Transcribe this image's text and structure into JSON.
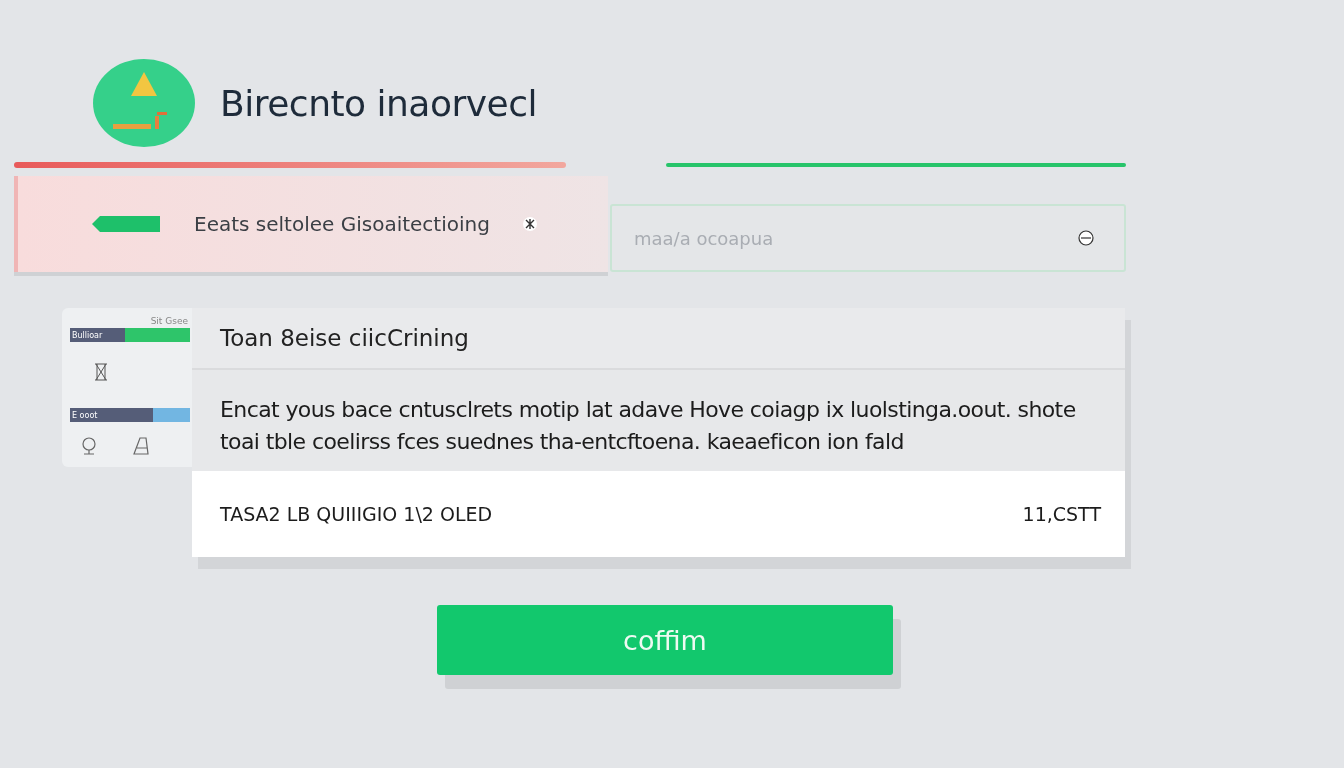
{
  "header": {
    "title": "Birecnto inaorvecl"
  },
  "search": {
    "label": "Eeats seltolee Gisoaitectioing",
    "placeholder": "maa/a ocoapua"
  },
  "sidebar": {
    "caption": "Sit Gsee",
    "meters": [
      {
        "label": "Bullioar",
        "level": 0.46,
        "color": "#2ec56a"
      },
      {
        "label": "E ooot",
        "level": 0.69,
        "color": "#72b6e2"
      }
    ]
  },
  "card": {
    "title": "Toan 8eise ciicCrining",
    "body": "Encat yous bace cntusclrets motip lat adave Hove coiagp ix luolstinga.oout. shote toai tble coelirss fces suednes tha-entcftoena. kaeaeficon ion fald",
    "footer_left": "TASA2 LB QUIIIGIO 1\\2 OLED",
    "footer_right": "11,CSTT"
  },
  "button": {
    "label": "coffim"
  }
}
